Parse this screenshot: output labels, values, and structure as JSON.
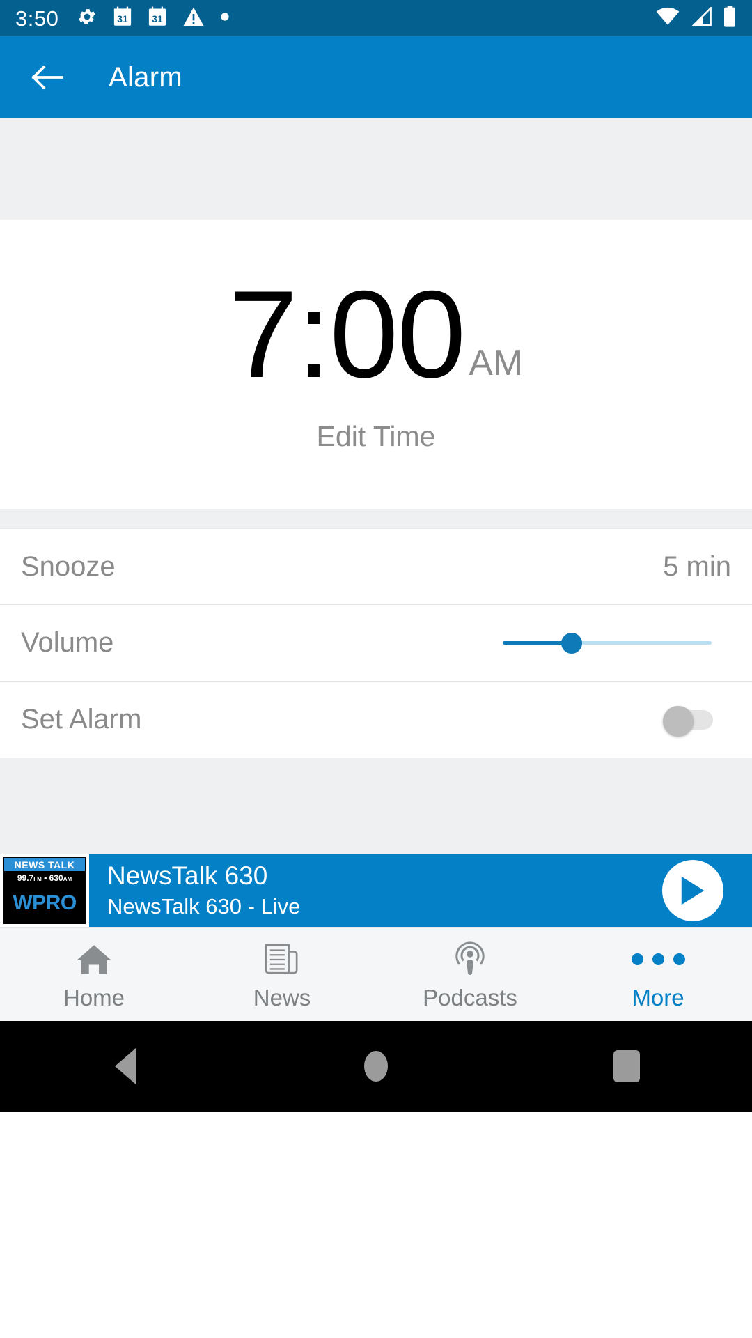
{
  "status_bar": {
    "clock": "3:50",
    "background": "#04608f",
    "left_icons": [
      "gear-icon",
      "calendar-31-icon",
      "calendar-31-icon",
      "warning-triangle-icon",
      "dot-icon"
    ],
    "right_icons": [
      "wifi-icon",
      "cellular-no-signal-icon",
      "battery-full-icon"
    ]
  },
  "app_bar": {
    "back_icon": "arrow-left-icon",
    "title": "Alarm",
    "background": "#0380c6"
  },
  "alarm": {
    "time": "7:00",
    "meridiem": "AM",
    "edit_label": "Edit Time"
  },
  "settings": {
    "rows": [
      {
        "label": "Snooze",
        "value": "5 min",
        "control": "text"
      },
      {
        "label": "Volume",
        "value": "",
        "control": "slider"
      },
      {
        "label": "Set Alarm",
        "value": "",
        "control": "toggle"
      }
    ],
    "volume_percent": 33,
    "set_alarm_on": false
  },
  "player": {
    "logo": {
      "top": "NEWS TALK",
      "mid_left": "99.7",
      "mid_left_small": "FM",
      "mid_sep": "•",
      "mid_right": "630",
      "mid_right_small": "AM",
      "call_letters": "WPRO"
    },
    "title": "NewsTalk 630",
    "subtitle": "NewsTalk 630 - Live",
    "play_icon": "play-icon",
    "background": "#0380c6"
  },
  "bottom_nav": {
    "items": [
      {
        "label": "Home",
        "icon": "home-icon",
        "active": false
      },
      {
        "label": "News",
        "icon": "newspaper-icon",
        "active": false
      },
      {
        "label": "Podcasts",
        "icon": "podcast-icon",
        "active": false
      },
      {
        "label": "More",
        "icon": "ellipsis-icon",
        "active": true
      }
    ],
    "accent": "#0380c6",
    "inactive": "#7e8183"
  },
  "system_nav": {
    "back": "back-triangle-icon",
    "home": "home-circle-icon",
    "recents": "recents-square-icon"
  }
}
